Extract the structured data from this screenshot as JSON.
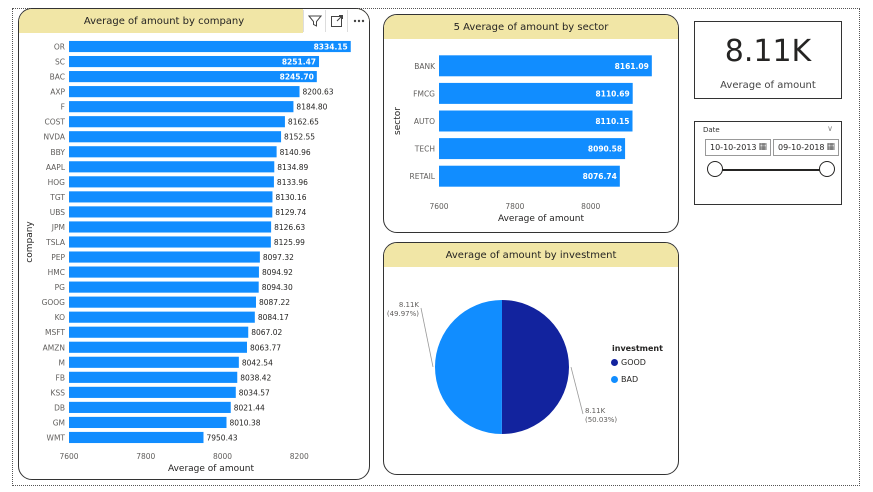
{
  "company_chart": {
    "title": "Average of amount by company",
    "icons": [
      "filter-icon",
      "focus-mode-icon",
      "more-options-icon"
    ]
  },
  "sector_chart": {
    "title": "5 Average of amount by sector"
  },
  "invest_chart": {
    "title": "Average of amount by investment"
  },
  "kpi": {
    "value": "8.11K",
    "label": "Average of amount"
  },
  "date_slicer": {
    "title": "Date",
    "start": "10-10-2013",
    "end": "09-10-2018",
    "start_fraction": 0,
    "end_fraction": 1
  },
  "colors": {
    "bar": "#118dff",
    "good": "#12239e",
    "bad": "#118dff",
    "header": "#f1e6a6"
  },
  "chart_data": [
    {
      "type": "bar",
      "orientation": "horizontal",
      "title": "Average of amount by company",
      "xlabel": "Average of amount",
      "ylabel": "company",
      "xlim": [
        7600,
        8340
      ],
      "xticks": [
        "7600",
        "7800",
        "8000",
        "8200"
      ],
      "categories": [
        "OR",
        "SC",
        "BAC",
        "AXP",
        "F",
        "COST",
        "NVDA",
        "BBY",
        "AAPL",
        "HOG",
        "TGT",
        "UBS",
        "JPM",
        "TSLA",
        "PEP",
        "HMC",
        "PG",
        "GOOG",
        "KO",
        "MSFT",
        "AMZN",
        "M",
        "FB",
        "KSS",
        "DB",
        "GM",
        "WMT"
      ],
      "values": [
        8334.15,
        8251.47,
        8245.7,
        8200.63,
        8184.8,
        8162.65,
        8152.55,
        8140.96,
        8134.89,
        8133.96,
        8130.16,
        8129.74,
        8126.63,
        8125.99,
        8097.32,
        8094.92,
        8094.3,
        8087.22,
        8084.17,
        8067.02,
        8063.77,
        8042.54,
        8038.42,
        8034.57,
        8021.44,
        8010.38,
        7950.43
      ],
      "labels": [
        "8334.15",
        "8251.47",
        "8245.70",
        "8200.63",
        "8184.80",
        "8162.65",
        "8152.55",
        "8140.96",
        "8134.89",
        "8133.96",
        "8130.16",
        "8129.74",
        "8126.63",
        "8125.99",
        "8097.32",
        "8094.92",
        "8094.30",
        "8087.22",
        "8084.17",
        "8067.02",
        "8063.77",
        "8042.54",
        "8038.42",
        "8034.57",
        "8021.44",
        "8010.38",
        "7950.43"
      ]
    },
    {
      "type": "bar",
      "orientation": "horizontal",
      "title": "5 Average of amount by sector",
      "xlabel": "Average of amount",
      "ylabel": "sector",
      "xlim": [
        7600,
        8180
      ],
      "xticks": [
        "7600",
        "7800",
        "8000"
      ],
      "categories": [
        "BANK",
        "FMCG",
        "AUTO",
        "TECH",
        "RETAIL"
      ],
      "values": [
        8161.09,
        8110.69,
        8110.15,
        8090.58,
        8076.74
      ],
      "labels": [
        "8161.09",
        "8110.69",
        "8110.15",
        "8090.58",
        "8076.74"
      ]
    },
    {
      "type": "pie",
      "title": "Average of amount by investment",
      "legend_title": "investment",
      "categories": [
        "GOOD",
        "BAD"
      ],
      "values": [
        8110,
        8100
      ],
      "percent": [
        50.03,
        49.97
      ],
      "labels": [
        "8.11K",
        "8.11K"
      ],
      "percent_labels": [
        "(50.03%)",
        "(49.97%)"
      ]
    }
  ]
}
